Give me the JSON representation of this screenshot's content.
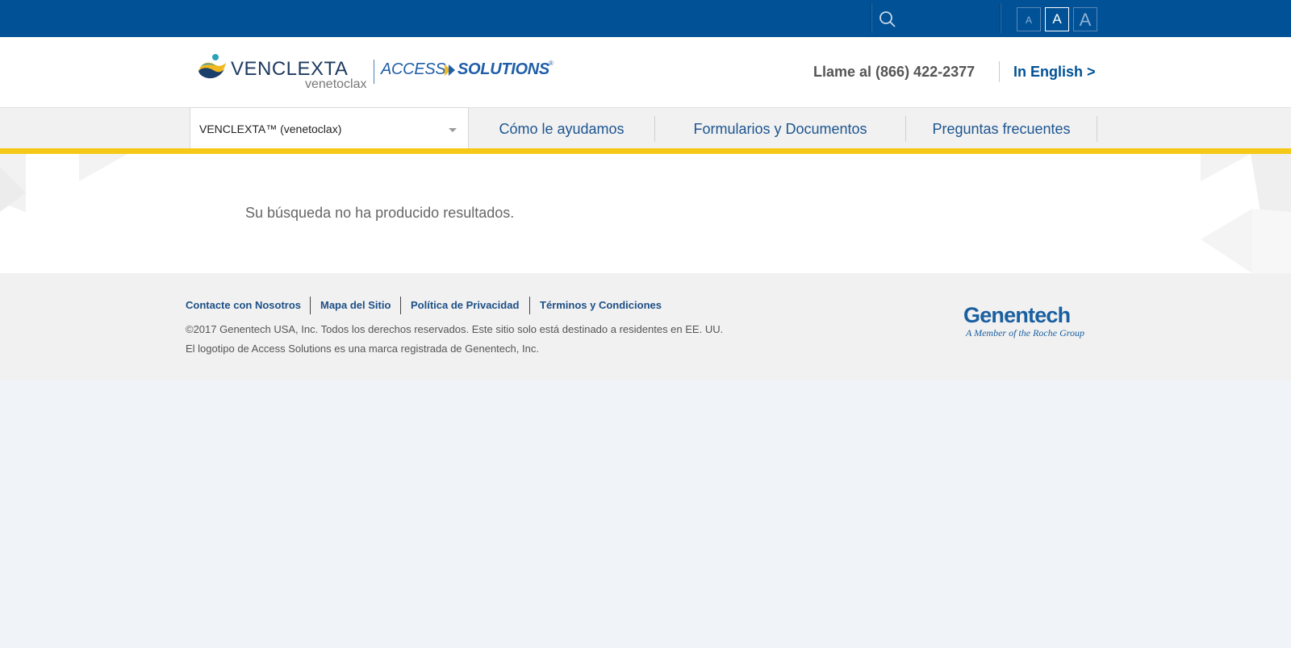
{
  "topbar": {
    "search": {
      "icon": "search-icon",
      "placeholder": "",
      "value": ""
    },
    "font_sizes": [
      {
        "label": "A",
        "size": "small",
        "active": false
      },
      {
        "label": "A",
        "size": "medium",
        "active": true
      },
      {
        "label": "A",
        "size": "large",
        "active": false
      }
    ]
  },
  "header": {
    "logo": {
      "brand": "VENCLEXTA",
      "generic": "venetoclax",
      "program_access": "ACCESS",
      "program_solutions": "SOLUTIONS",
      "reg": "®"
    },
    "phone": "Llame al (866) 422-2377",
    "language_link": "In English >"
  },
  "nav": {
    "product_select": "VENCLEXTA™ (venetoclax)",
    "items": [
      "Cómo le ayudamos",
      "Formularios y Documentos",
      "Preguntas frecuentes"
    ]
  },
  "main": {
    "message": "Su búsqueda no ha producido resultados."
  },
  "footer": {
    "links": [
      "Contacte con Nosotros",
      "Mapa del Sitio",
      "Política de Privacidad",
      "Términos y Condiciones"
    ],
    "copyright": "©2017 Genentech USA, Inc. Todos los derechos reservados.  Este sitio solo está destinado a residentes en EE. UU.",
    "trademark": "El logotipo de Access Solutions es una marca registrada de Genentech, Inc.",
    "company_logo": {
      "name": "Genentech",
      "tagline": "A Member of the Roche Group"
    }
  },
  "colors": {
    "topbar": "#005196",
    "accent_yellow": "#f6c918",
    "link_blue": "#1d5590",
    "page_background": "#f0f3f7"
  }
}
